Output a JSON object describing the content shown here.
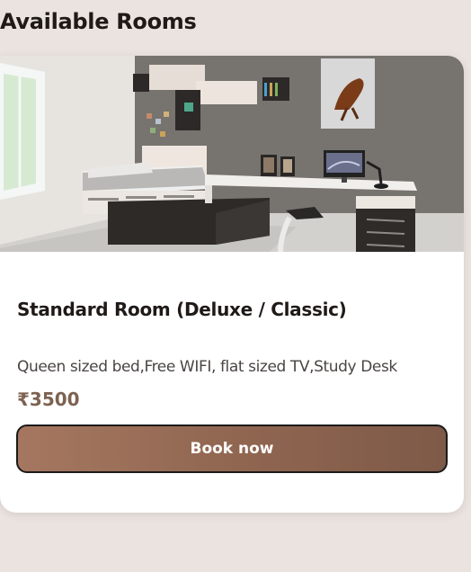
{
  "section": {
    "title": "Available Rooms"
  },
  "room": {
    "image_alt": "Bedroom with bed, shelves, desk and computer",
    "name": "Standard Room (Deluxe / Classic)",
    "features": "Queen sized bed,Free WIFI, flat sized TV,Study Desk",
    "price": "₹3500",
    "button_label": "Book now"
  },
  "colors": {
    "page_background": "#ebe3df",
    "card_background": "#ffffff",
    "price_color": "#7d6251",
    "button_gradient_start": "#a57760",
    "button_gradient_end": "#7e5a48",
    "button_border": "#1c1a19"
  }
}
